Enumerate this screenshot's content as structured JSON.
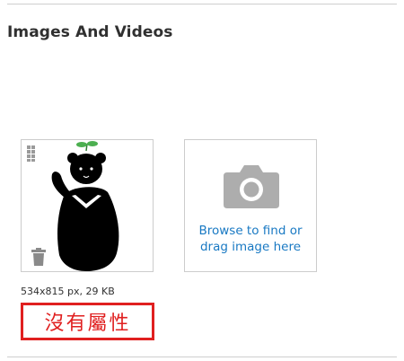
{
  "section": {
    "title": "Images And Videos"
  },
  "image_tile": {
    "file_info": "534x815 px, 29 KB",
    "drag_icon": "drag-handle-icon",
    "delete_icon": "trash-icon"
  },
  "upload_tile": {
    "icon": "camera-icon",
    "line1": "Browse to find or",
    "line2": "drag image here"
  },
  "annotation": {
    "text": "沒有屬性",
    "color": "#e02020"
  },
  "colors": {
    "link": "#1979c3",
    "border": "#cccccc",
    "icon_gray": "#adadad"
  }
}
